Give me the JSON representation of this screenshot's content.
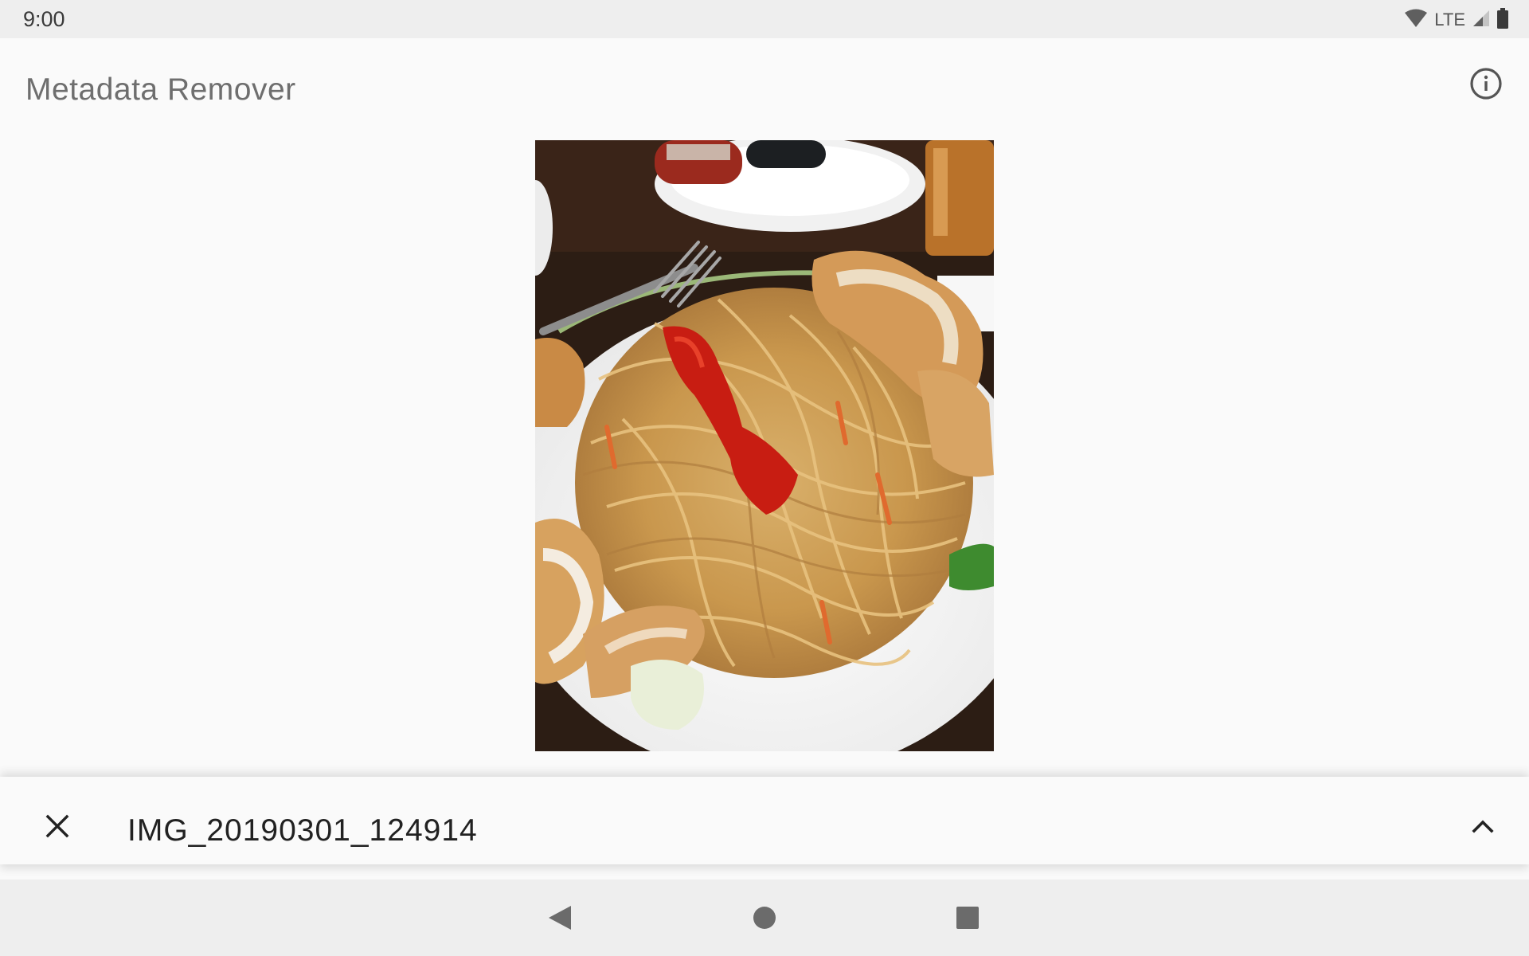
{
  "status_bar": {
    "time": "9:00",
    "network_label": "LTE",
    "icons": [
      "wifi-icon",
      "cell-signal-icon",
      "battery-icon"
    ]
  },
  "app_bar": {
    "title": "Metadata Remover",
    "action_icon": "info-icon"
  },
  "image_preview": {
    "subject": "photo of a plate of fried noodles with chicken and chili sauce"
  },
  "bottom_sheet": {
    "file_name": "IMG_20190301_124914",
    "close_icon": "close-icon",
    "expand_icon": "chevron-up-icon"
  },
  "nav_bar": {
    "buttons": [
      "back-icon",
      "home-icon",
      "recents-icon"
    ]
  },
  "colors": {
    "status_bar_bg": "#eeeeee",
    "app_bg": "#fafafa",
    "title_text": "#6e6e6e",
    "primary_text": "#212121"
  }
}
